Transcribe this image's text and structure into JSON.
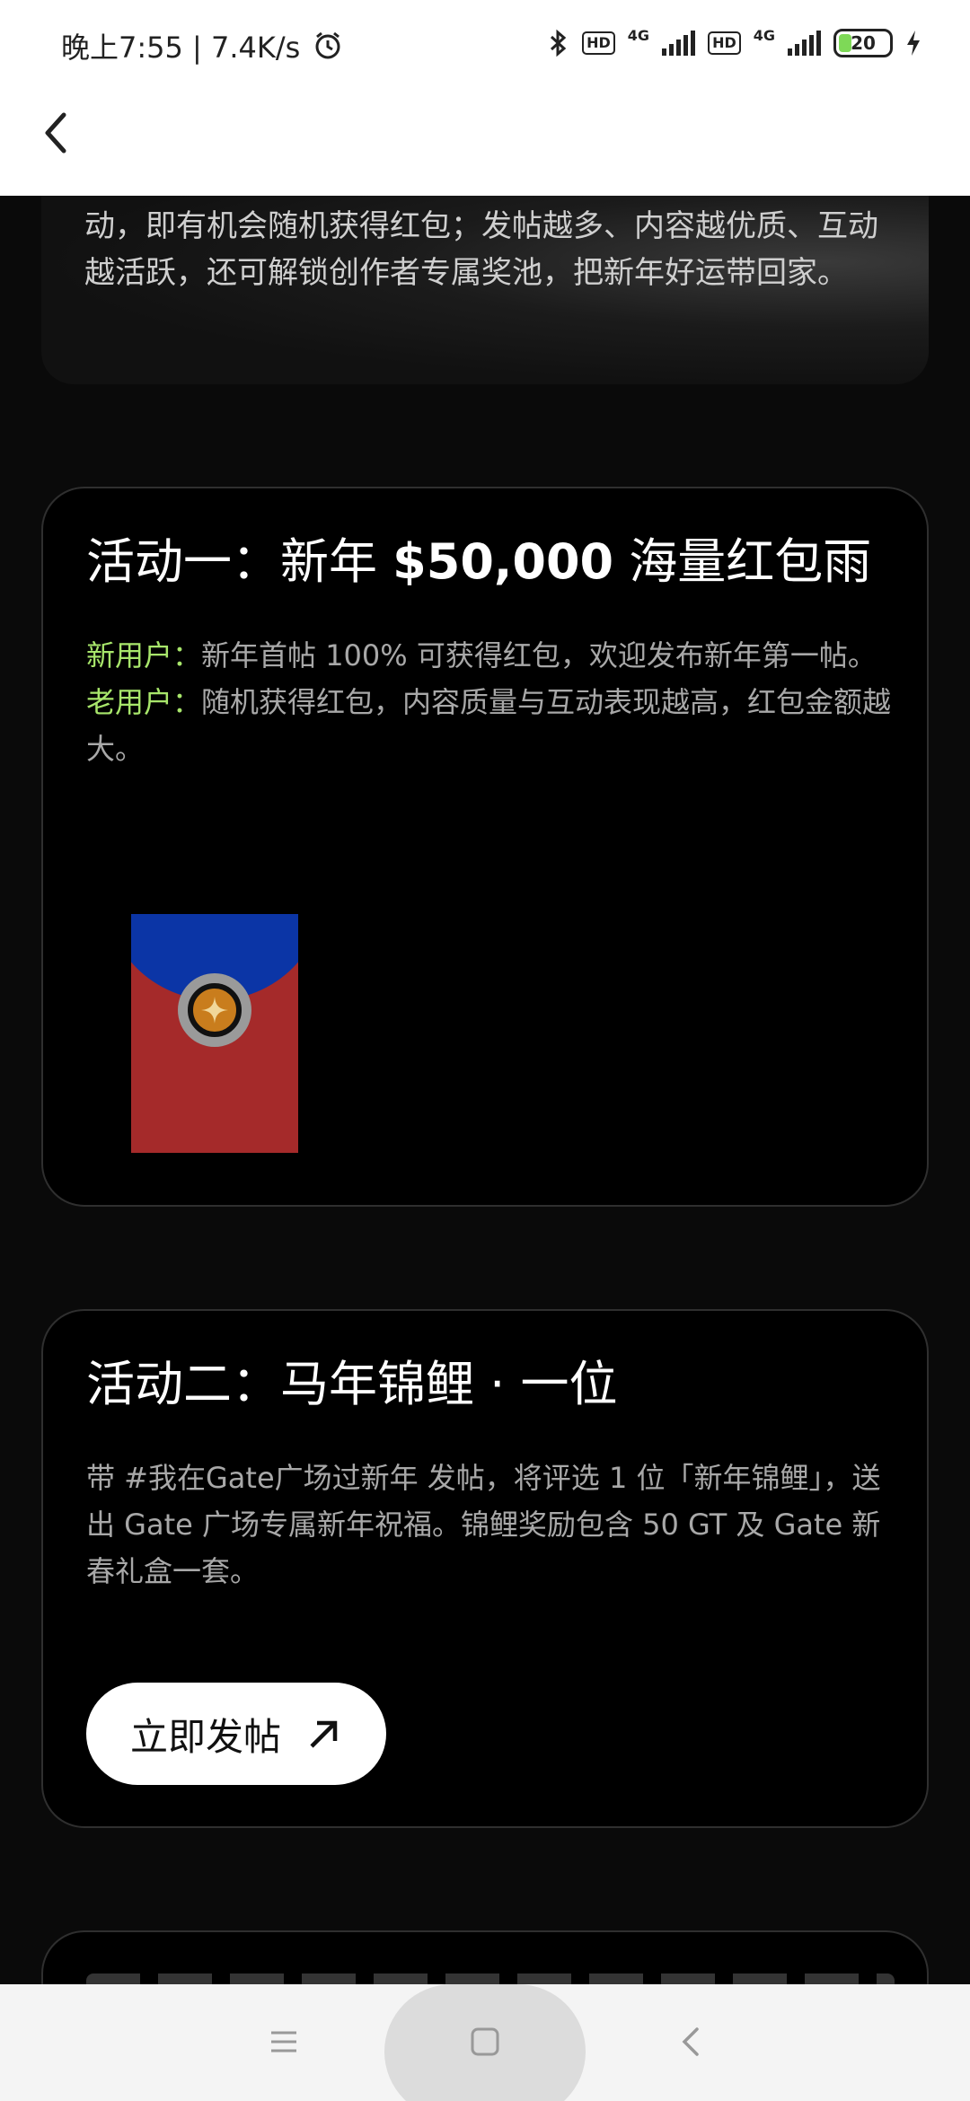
{
  "status_bar": {
    "time": "晚上7:55 | 7.4K/s",
    "hd1": "HD",
    "net1": "4G",
    "hd2": "HD",
    "net2": "4G",
    "battery": "20"
  },
  "header": {
    "back_icon": "chevron-left-icon"
  },
  "intro": {
    "text": "动，即有机会随机获得红包；发帖越多、内容越优质、互动越活跃，还可解锁创作者专属奖池，把新年好运带回家。"
  },
  "activity1": {
    "title_prefix": "活动一：新年 ",
    "title_amount": "$50,000",
    "title_suffix": " 海量红包雨",
    "new_user_label": "新用户：",
    "new_user_text": "新年首帖 100% 可获得红包，欢迎发布新年第一帖。",
    "old_user_label": "老用户：",
    "old_user_text": "随机获得红包，内容质量与互动表现越高，红包金额越大。"
  },
  "activity2": {
    "title": "活动二：马年锦鲤 · 一位",
    "body": "带 #我在Gate广场过新年 发帖，将评选 1 位「新年锦鲤」，送出 Gate 广场专属新年祝福。锦鲤奖励包含 50 GT 及 Gate 新春礼盒一套。",
    "button_label": "立即发帖"
  },
  "colors": {
    "accent_green": "#a8e66b",
    "envelope_red": "#a52a2a",
    "envelope_blue": "#0b35a6",
    "seal_gold": "#c97d1d"
  },
  "navbar": {
    "menu_icon": "menu-icon",
    "home_icon": "home-square-icon",
    "back_icon": "back-triangle-icon"
  }
}
